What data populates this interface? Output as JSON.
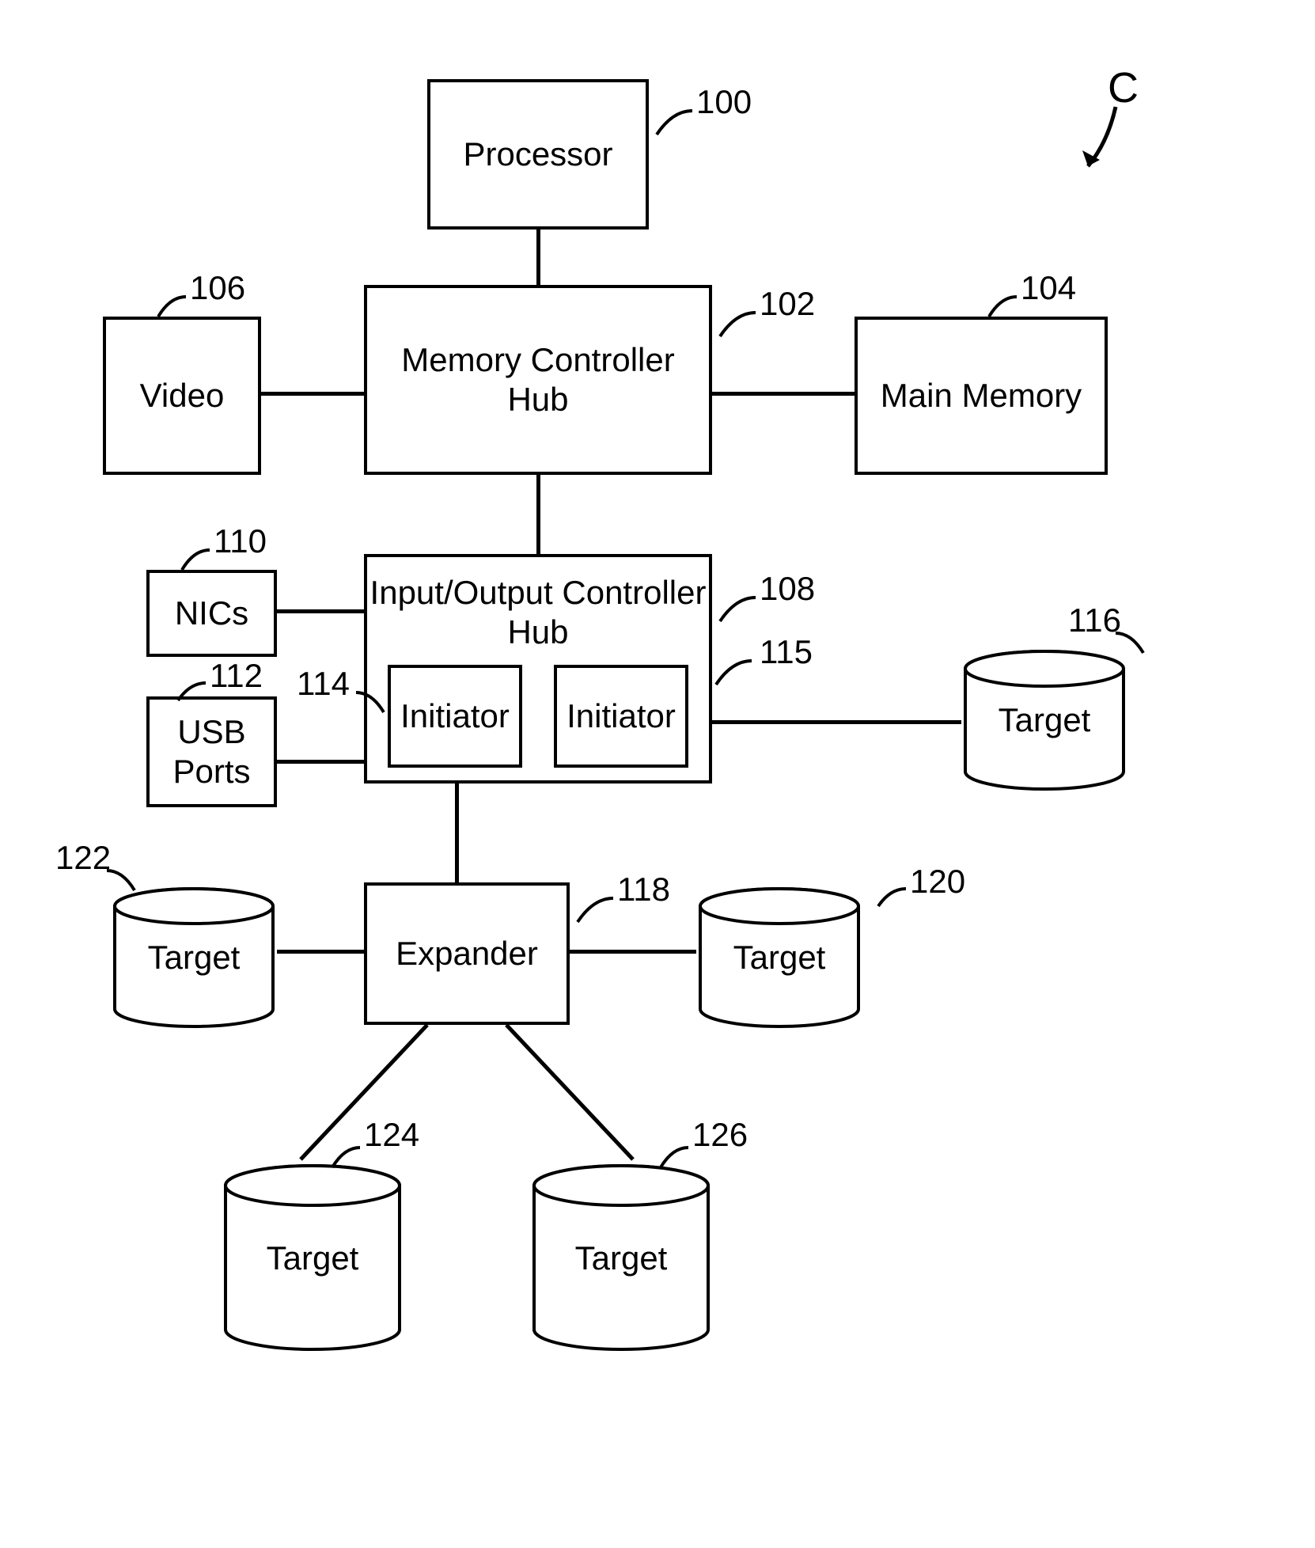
{
  "system_label": "C",
  "blocks": {
    "processor": {
      "label": "Processor",
      "ref": "100"
    },
    "mch": {
      "label": "Memory Controller\nHub",
      "ref": "102"
    },
    "main_memory": {
      "label": "Main Memory",
      "ref": "104"
    },
    "video": {
      "label": "Video",
      "ref": "106"
    },
    "ioch": {
      "label": "Input/Output Controller\nHub",
      "ref": "108"
    },
    "nics": {
      "label": "NICs",
      "ref": "110"
    },
    "usb": {
      "label": "USB\nPorts",
      "ref": "112"
    },
    "initiator1": {
      "label": "Initiator",
      "ref": "114"
    },
    "initiator2": {
      "label": "Initiator",
      "ref": "115"
    },
    "target116": {
      "label": "Target",
      "ref": "116"
    },
    "expander": {
      "label": "Expander",
      "ref": "118"
    },
    "target120": {
      "label": "Target",
      "ref": "120"
    },
    "target122": {
      "label": "Target",
      "ref": "122"
    },
    "target124": {
      "label": "Target",
      "ref": "124"
    },
    "target126": {
      "label": "Target",
      "ref": "126"
    }
  }
}
